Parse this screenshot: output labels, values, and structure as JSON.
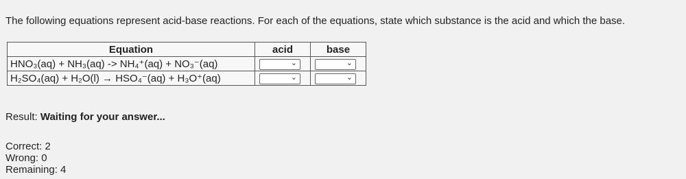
{
  "question": "The following equations represent acid-base reactions. For each of the equations, state which substance is the acid and which the base.",
  "table": {
    "headers": {
      "equation": "Equation",
      "acid": "acid",
      "base": "base"
    },
    "rows": [
      {
        "equation": "HNO₃(aq) + NH₃(aq) -> NH₄⁺(aq) + NO₃⁻(aq)",
        "acid_value": "",
        "base_value": ""
      },
      {
        "equation": "H₂SO₄(aq) + H₂O(l) → HSO₄⁻(aq) + H₃O⁺(aq)",
        "acid_value": "",
        "base_value": ""
      }
    ]
  },
  "result": {
    "label": "Result:",
    "value": "Waiting for your answer..."
  },
  "stats": {
    "correct": "Correct: 2",
    "wrong": "Wrong: 0",
    "remaining": "Remaining: 4"
  },
  "icons": {
    "dropdown": "chevron-down-icon"
  }
}
